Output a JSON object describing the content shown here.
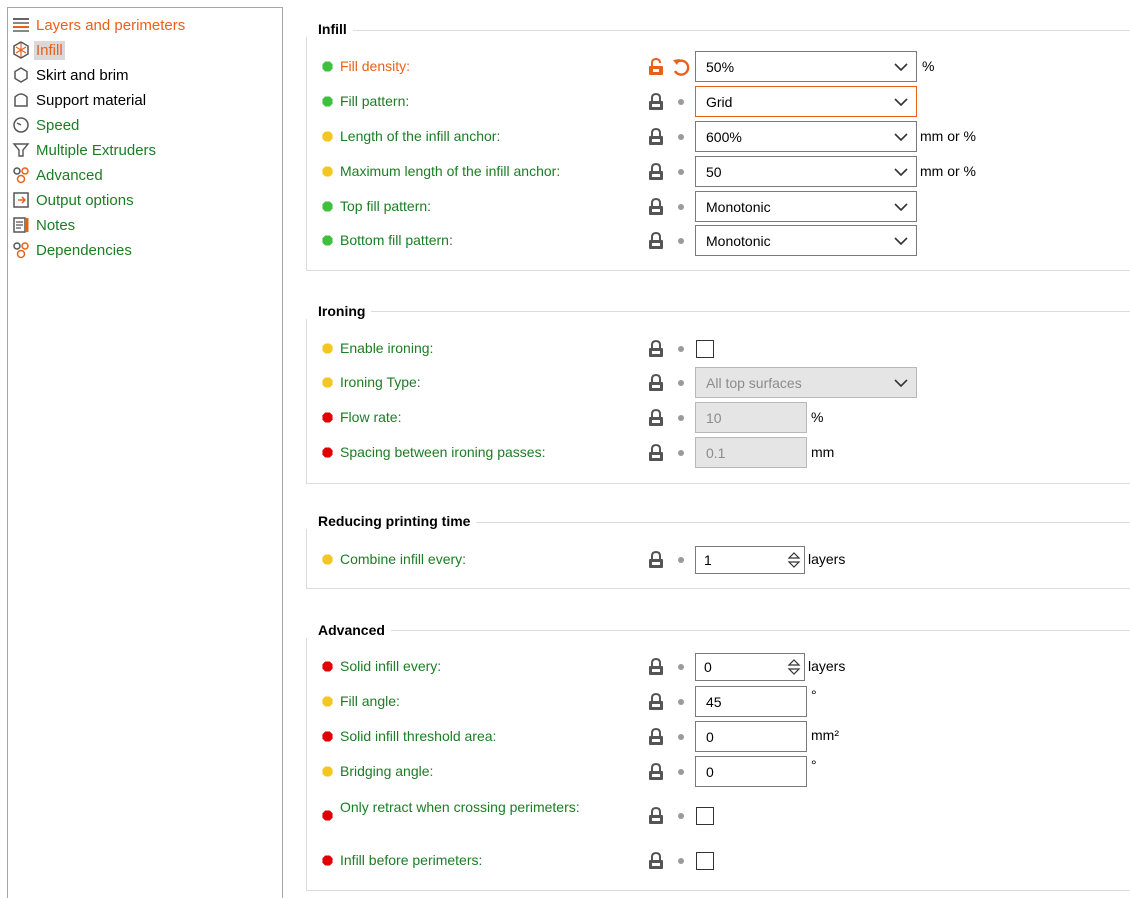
{
  "colors": {
    "accent": "#e8611b",
    "label_green": "#1b7d24",
    "simple": "#3ec03e",
    "advanced": "#f3c623",
    "expert": "#e00000"
  },
  "sidebar": {
    "items": [
      {
        "label": "Layers and perimeters",
        "icon": "layers-icon"
      },
      {
        "label": "Infill",
        "icon": "infill-icon"
      },
      {
        "label": "Skirt and brim",
        "icon": "skirt-brim-icon"
      },
      {
        "label": "Support material",
        "icon": "support-icon"
      },
      {
        "label": "Speed",
        "icon": "speed-icon"
      },
      {
        "label": "Multiple Extruders",
        "icon": "extruder-icon"
      },
      {
        "label": "Advanced",
        "icon": "advanced-icon"
      },
      {
        "label": "Output options",
        "icon": "output-icon"
      },
      {
        "label": "Notes",
        "icon": "notes-icon"
      },
      {
        "label": "Dependencies",
        "icon": "dependencies-icon"
      }
    ]
  },
  "infill": {
    "title": "Infill",
    "fill_density": {
      "label": "Fill density:",
      "value": "50%",
      "unit": "%"
    },
    "fill_pattern": {
      "label": "Fill pattern:",
      "value": "Grid"
    },
    "anchor_length": {
      "label": "Length of the infill anchor:",
      "value": "600%",
      "unit": "mm or %"
    },
    "anchor_max": {
      "label": "Maximum length of the infill anchor:",
      "value": "50",
      "unit": "mm or %"
    },
    "top_pattern": {
      "label": "Top fill pattern:",
      "value": "Monotonic"
    },
    "bottom_pattern": {
      "label": "Bottom fill pattern:",
      "value": "Monotonic"
    }
  },
  "ironing": {
    "title": "Ironing",
    "enable": {
      "label": "Enable ironing:",
      "checked": false
    },
    "type": {
      "label": "Ironing Type:",
      "value": "All top surfaces"
    },
    "flow": {
      "label": "Flow rate:",
      "value": "10",
      "unit": "%"
    },
    "spacing": {
      "label": "Spacing between ironing passes:",
      "value": "0.1",
      "unit": "mm"
    }
  },
  "reducing": {
    "title": "Reducing printing time",
    "combine": {
      "label": "Combine infill every:",
      "value": "1",
      "unit": "layers"
    }
  },
  "advanced": {
    "title": "Advanced",
    "solid_every": {
      "label": "Solid infill every:",
      "value": "0",
      "unit": "layers"
    },
    "fill_angle": {
      "label": "Fill angle:",
      "value": "45",
      "unit": "°"
    },
    "threshold": {
      "label": "Solid infill threshold area:",
      "value": "0",
      "unit": "mm²"
    },
    "bridging": {
      "label": "Bridging angle:",
      "value": "0",
      "unit": "°"
    },
    "only_retract": {
      "label": "Only retract when crossing perimeters:",
      "checked": false
    },
    "infill_first": {
      "label": "Infill before perimeters:",
      "checked": false
    }
  }
}
